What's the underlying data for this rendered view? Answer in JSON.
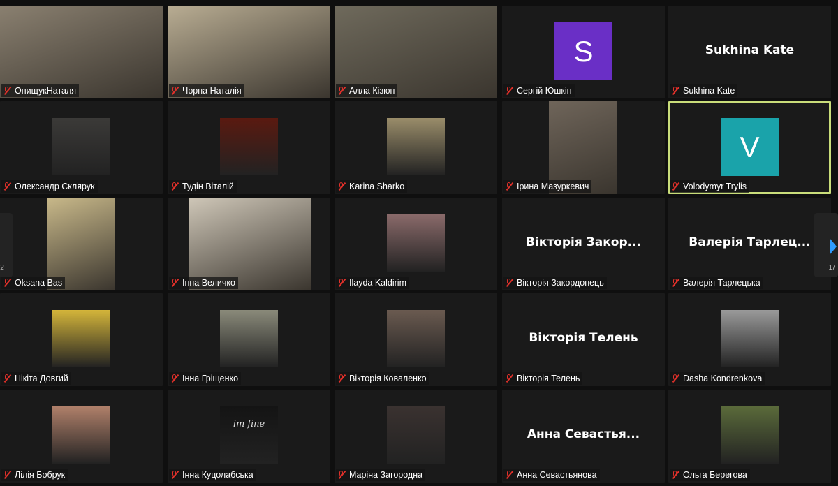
{
  "colors": {
    "active_border": "#c9dd7a",
    "mic_muted": "#e0302a",
    "nav_arrow": "#2f9bff"
  },
  "navigation": {
    "left_page": "2",
    "right_page": "1/",
    "right_icon": "chevron-right-icon"
  },
  "participants": [
    {
      "name": "ОнищукНаталя",
      "kind": "video",
      "bg": "#8a8070"
    },
    {
      "name": "Чорна Наталія",
      "kind": "video",
      "bg": "#b9ad93"
    },
    {
      "name": "Алла Кізюн",
      "kind": "video",
      "bg": "#6f6a5c"
    },
    {
      "name": "Сергій Юшкін",
      "kind": "avatar",
      "letter": "S",
      "bg": "#6a2fc6"
    },
    {
      "name": "Sukhina Kate",
      "kind": "text",
      "display": "Sukhina Kate"
    },
    {
      "name": "Олександр Склярук",
      "kind": "photo",
      "bg": "#3b3a38"
    },
    {
      "name": "Тудін Віталій",
      "kind": "photo",
      "bg": "#5a1a10"
    },
    {
      "name": "Karina Sharko",
      "kind": "photo",
      "bg": "#9a8d6a"
    },
    {
      "name": "Ірина Мазуркевич",
      "kind": "video",
      "bg": "#6f655a"
    },
    {
      "name": "Volodymyr Trylis",
      "kind": "avatar",
      "letter": "V",
      "bg": "#1aa3aa",
      "active": true
    },
    {
      "name": "Oksana Bas",
      "kind": "video",
      "bg": "#c9b98a"
    },
    {
      "name": "Інна Величко",
      "kind": "video",
      "bg": "#cfc7b8"
    },
    {
      "name": "Ilayda Kaldirim",
      "kind": "photo",
      "bg": "#8a6a6a"
    },
    {
      "name": "Вікторія Закордонець",
      "kind": "text",
      "display": "Вікторія Закор..."
    },
    {
      "name": "Валерія Тарлецька",
      "kind": "text",
      "display": "Валерія  Тарлец..."
    },
    {
      "name": "Нікіта Довгий",
      "kind": "photo",
      "bg": "#d4b53a"
    },
    {
      "name": "Інна Гріщенко",
      "kind": "photo",
      "bg": "#8a8a7a"
    },
    {
      "name": "Вікторія Коваленко",
      "kind": "photo",
      "bg": "#6a5a50"
    },
    {
      "name": "Вікторія Телень",
      "kind": "text",
      "display": "Вікторія Телень"
    },
    {
      "name": "Dasha Kondrenkova",
      "kind": "photo",
      "bg": "#9a9a9a"
    },
    {
      "name": "Лілія Бобрук",
      "kind": "photo",
      "bg": "#b0806a"
    },
    {
      "name": "Інна Куцолабська",
      "kind": "photo",
      "bg": "#141414",
      "caption": "im fine"
    },
    {
      "name": "Маріна Загородна",
      "kind": "photo",
      "bg": "#3a3230"
    },
    {
      "name": "Анна Севастьянова",
      "kind": "text",
      "display": "Анна  Севастья..."
    },
    {
      "name": "Ольга Берегова",
      "kind": "photo",
      "bg": "#5a6a3a"
    }
  ]
}
